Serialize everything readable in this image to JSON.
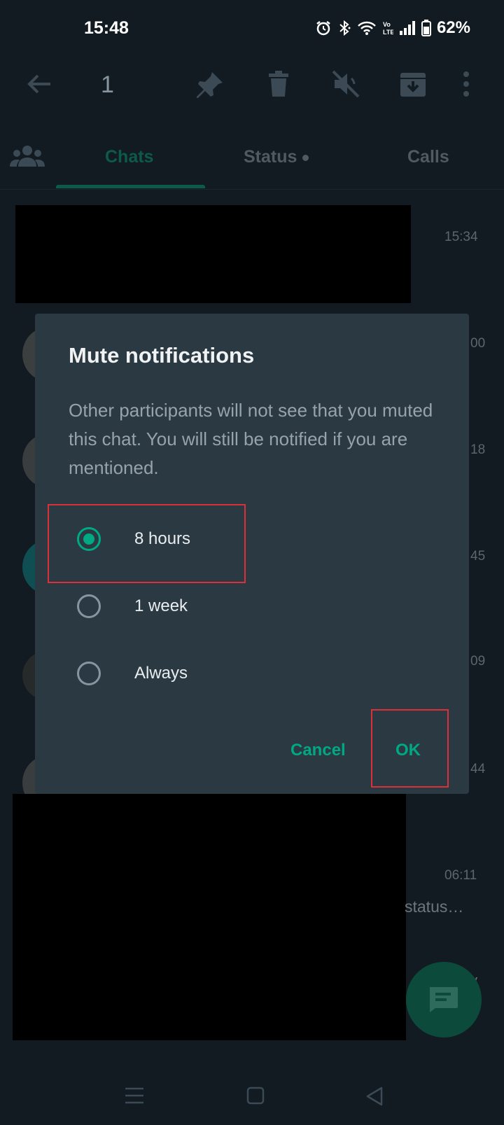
{
  "status_bar": {
    "time": "15:48",
    "battery": "62%"
  },
  "toolbar": {
    "selected_count": "1"
  },
  "tabs": [
    {
      "label": "Chats",
      "active": true
    },
    {
      "label": "Status",
      "active": false
    },
    {
      "label": "Calls",
      "active": false
    }
  ],
  "chat_list": {
    "times": [
      "15:34",
      "00",
      "18",
      "45",
      "09",
      "44",
      "06:11"
    ],
    "preview_snippet": "status…",
    "preview_tail": "y"
  },
  "dialog": {
    "title": "Mute notifications",
    "body": "Other participants will not see that you muted this chat. You will still be notified if you are mentioned.",
    "options": [
      {
        "label": "8 hours",
        "selected": true
      },
      {
        "label": "1 week",
        "selected": false
      },
      {
        "label": "Always",
        "selected": false
      }
    ],
    "cancel_label": "Cancel",
    "ok_label": "OK"
  },
  "colors": {
    "accent": "#00a884",
    "dialog_bg": "#2a3942",
    "highlight_box": "#d9303a"
  },
  "icons": {
    "toolbar": [
      "back-arrow-icon",
      "pin-icon",
      "delete-icon",
      "mute-icon",
      "archive-icon",
      "more-options-icon"
    ],
    "fab": "new-chat-icon",
    "navbar": [
      "recent-apps-icon",
      "home-icon",
      "back-icon"
    ]
  }
}
